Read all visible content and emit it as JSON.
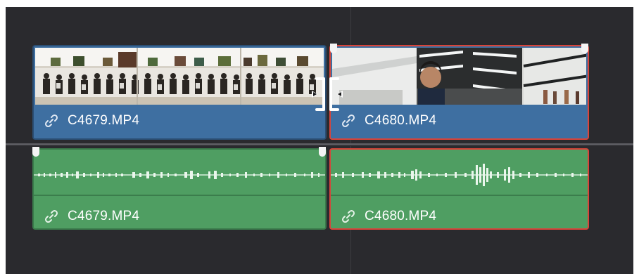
{
  "timeline": {
    "video_track": {
      "clips": [
        {
          "name": "C4679.MP4",
          "selected": false
        },
        {
          "name": "C4680.MP4",
          "selected": true
        }
      ]
    },
    "audio_track": {
      "clips": [
        {
          "name": "C4679.MP4",
          "selected": false
        },
        {
          "name": "C4680.MP4",
          "selected": true
        }
      ]
    },
    "icons": {
      "clip_link": "link-icon",
      "trim_tool": "ripple-trim-bracket-icon"
    },
    "colors": {
      "background": "#2a2a2e",
      "video_clip": "#3e6fa1",
      "audio_clip": "#4f9e62",
      "selection": "#d9443a"
    }
  }
}
